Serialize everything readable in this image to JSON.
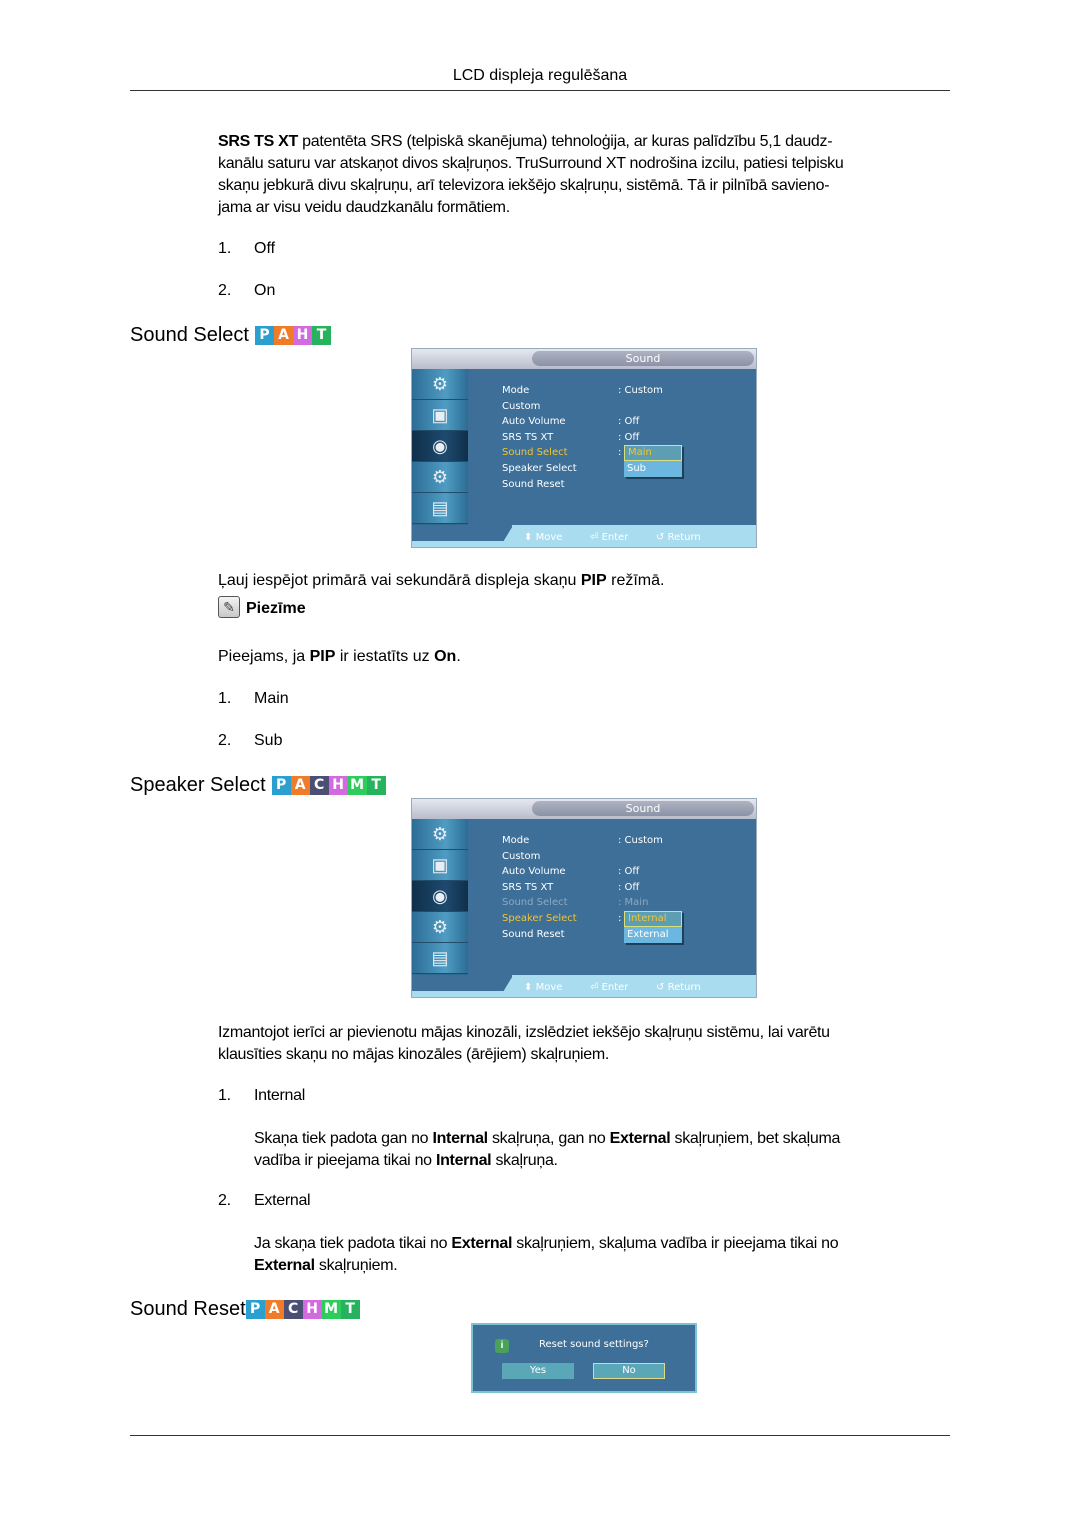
{
  "header": {
    "title": "LCD displeja regulēšana"
  },
  "srs_section": {
    "intro_bold": "SRS TS XT",
    "intro_lines": [
      " patentēta SRS (telpiskā skanējuma) tehnoloģija, ar kuras palīdzību 5,1 daudz-",
      "kanālu saturu var atskaņot divos skaļruņos. TruSurround XT nodrošina izcilu, patiesi telpisku",
      "skaņu jebkurā divu skaļruņu, arī televizora iekšējo skaļruņu, sistēmā. Tā ir pilnībā savieno-",
      "jama ar visu veidu daudzkanālu formātiem."
    ],
    "options": [
      {
        "num": "1.",
        "label": "Off"
      },
      {
        "num": "2.",
        "label": "On"
      }
    ]
  },
  "badge_colors": {
    "P": "#2a9fd0",
    "A": "#f07c2a",
    "C": "#4b4f74",
    "H": "#d36ae0",
    "M": "#2ecc5a",
    "T": "#27b35e"
  },
  "sound_select": {
    "heading": "Sound Select",
    "badges": [
      "P",
      "A",
      "H",
      "T"
    ],
    "osd": {
      "title": "Sound",
      "rows": [
        {
          "label": "Mode",
          "value": ": Custom"
        },
        {
          "label": "Custom",
          "value": ""
        },
        {
          "label": "Auto Volume",
          "value": ": Off"
        },
        {
          "label": "SRS TS XT",
          "value": ": Off"
        },
        {
          "label": "Sound Select",
          "value": ":"
        },
        {
          "label": "Speaker Select",
          "value": ""
        },
        {
          "label": "Sound Reset",
          "value": ""
        }
      ],
      "dropdown": [
        "Main",
        "Sub"
      ],
      "dropdown_selected": "Main",
      "hints": {
        "move": "Move",
        "enter": "Enter",
        "return": "Return"
      }
    },
    "description_parts": [
      "Ļauj iespējot primārā vai sekundārā displeja skaņu ",
      "PIP",
      " režīmā."
    ],
    "note_label": "Piezīme",
    "note_parts": [
      "Pieejams, ja ",
      "PIP",
      " ir iestatīts uz ",
      "On",
      "."
    ],
    "options": [
      {
        "num": "1.",
        "label": "Main"
      },
      {
        "num": "2.",
        "label": "Sub"
      }
    ]
  },
  "speaker_select": {
    "heading": "Speaker Select",
    "badges": [
      "P",
      "A",
      "C",
      "H",
      "M",
      "T"
    ],
    "osd": {
      "title": "Sound",
      "rows": [
        {
          "label": "Mode",
          "value": ": Custom"
        },
        {
          "label": "Custom",
          "value": ""
        },
        {
          "label": "Auto Volume",
          "value": ": Off"
        },
        {
          "label": "SRS TS XT",
          "value": ": Off"
        },
        {
          "label": "Sound Select",
          "value": ": Main"
        },
        {
          "label": "Speaker Select",
          "value": ":"
        },
        {
          "label": "Sound Reset",
          "value": ""
        }
      ],
      "dropdown": [
        "Internal",
        "External"
      ],
      "dropdown_selected": "Internal",
      "hints": {
        "move": "Move",
        "enter": "Enter",
        "return": "Return"
      }
    },
    "description_lines": [
      "Izmantojot ierīci ar pievienotu mājas kinozāli, izslēdziet iekšējo skaļruņu sistēmu, lai varētu",
      "klausīties skaņu no mājas kinozāles (ārējiem) skaļruņiem."
    ],
    "options": [
      {
        "num": "1.",
        "label": "Internal",
        "desc_parts": [
          "Skaņa tiek padota gan no ",
          "Internal",
          " skaļruņa, gan no ",
          "External",
          " skaļruņiem, bet skaļuma",
          "vadība ir pieejama tikai no ",
          "Internal",
          " skaļruņa."
        ]
      },
      {
        "num": "2.",
        "label": "External",
        "desc_parts": [
          "Ja skaņa tiek padota tikai no ",
          "External",
          " skaļruņiem, skaļuma vadība ir pieejama tikai no",
          "External",
          " skaļruņiem."
        ]
      }
    ]
  },
  "sound_reset": {
    "heading": "Sound Reset",
    "badges": [
      "P",
      "A",
      "C",
      "H",
      "M",
      "T"
    ],
    "dialog": {
      "message": "Reset sound settings?",
      "yes": "Yes",
      "no": "No",
      "info_icon": "i"
    }
  },
  "icons": {
    "note": "✎",
    "osd_tabs": [
      "⚙",
      "▣",
      "◉",
      "⚙",
      "▤"
    ],
    "move": "⬍",
    "enter": "⏎",
    "return": "↺"
  }
}
